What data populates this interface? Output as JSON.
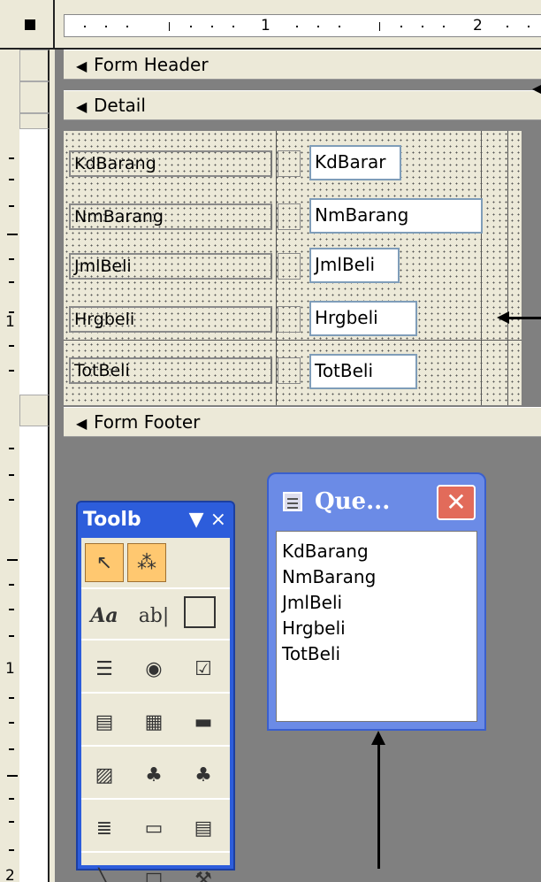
{
  "ruler": {
    "marks": [
      "1",
      "2"
    ]
  },
  "vruler": {
    "marks": [
      "1",
      "1",
      "2"
    ]
  },
  "sections": {
    "header": "Form Header",
    "detail": "Detail",
    "footer": "Form Footer"
  },
  "fields": [
    {
      "label": "KdBarang",
      "textbox": "KdBarar"
    },
    {
      "label": "NmBarang",
      "textbox": "NmBarang"
    },
    {
      "label": "JmlBeli",
      "textbox": "JmlBeli"
    },
    {
      "label": "Hrgbeli",
      "textbox": "Hrgbeli"
    },
    {
      "label": "TotBeli",
      "textbox": "TotBeli"
    }
  ],
  "toolbox": {
    "title": "Toolb",
    "dropdown_glyph": "▼",
    "close_glyph": "×",
    "label_tool_text": "Aa",
    "textbox_tool_text": "ab|",
    "tools": [
      "select-objects-icon",
      "control-wizards-icon",
      "label-icon",
      "textbox-icon",
      "option-group-icon",
      "toggle-button-icon",
      "option-button-icon",
      "checkbox-icon",
      "combo-box-icon",
      "list-box-icon",
      "command-button-icon",
      "image-icon",
      "unbound-object-frame-icon",
      "bound-object-frame-icon",
      "page-break-icon",
      "tab-control-icon",
      "subform-icon",
      "line-icon",
      "rectangle-icon",
      "more-controls-icon"
    ]
  },
  "query_window": {
    "title": "Que...",
    "close_glyph": "✕",
    "fields": [
      "KdBarang",
      "NmBarang",
      "JmlBeli",
      "Hrgbeli",
      "TotBeli"
    ]
  },
  "colors": {
    "toolbox_title": "#2d5ddb",
    "query_title": "#6b8be6",
    "close_button": "#e26b5a",
    "selected_tool": "#ffc870",
    "design_bg": "#808080"
  }
}
